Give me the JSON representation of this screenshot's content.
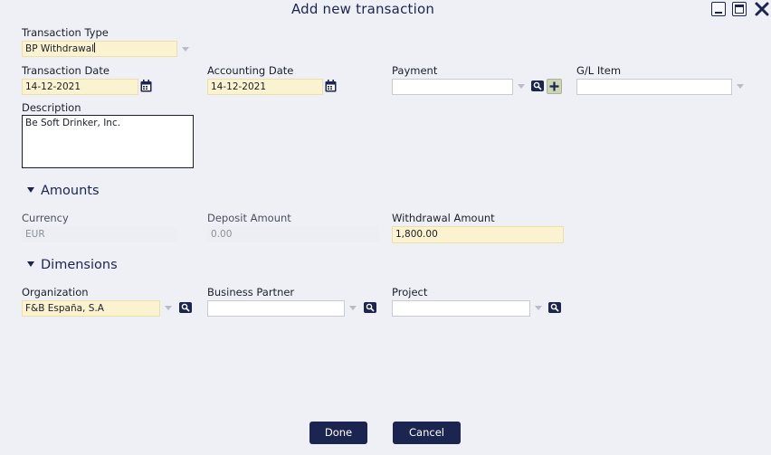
{
  "window": {
    "title": "Add new transaction"
  },
  "form": {
    "transaction_type": {
      "label": "Transaction Type",
      "value": "BP Withdrawal"
    },
    "transaction_date": {
      "label": "Transaction Date",
      "value": "14-12-2021"
    },
    "accounting_date": {
      "label": "Accounting Date",
      "value": "14-12-2021"
    },
    "payment": {
      "label": "Payment",
      "value": ""
    },
    "gl_item": {
      "label": "G/L Item",
      "value": ""
    },
    "description": {
      "label": "Description",
      "value": "Be Soft Drinker, Inc."
    }
  },
  "amounts": {
    "title": "Amounts",
    "currency": {
      "label": "Currency",
      "value": "EUR"
    },
    "deposit": {
      "label": "Deposit Amount",
      "value": "0.00"
    },
    "withdrawal": {
      "label": "Withdrawal Amount",
      "value": "1,800.00"
    }
  },
  "dimensions": {
    "title": "Dimensions",
    "organization": {
      "label": "Organization",
      "value": "F&B España, S.A"
    },
    "business_partner": {
      "label": "Business Partner",
      "value": ""
    },
    "project": {
      "label": "Project",
      "value": ""
    }
  },
  "buttons": {
    "done": "Done",
    "cancel": "Cancel"
  },
  "colors": {
    "primary": "#1b2550",
    "required_field": "#fbf2cf",
    "background": "#eef0f6"
  }
}
